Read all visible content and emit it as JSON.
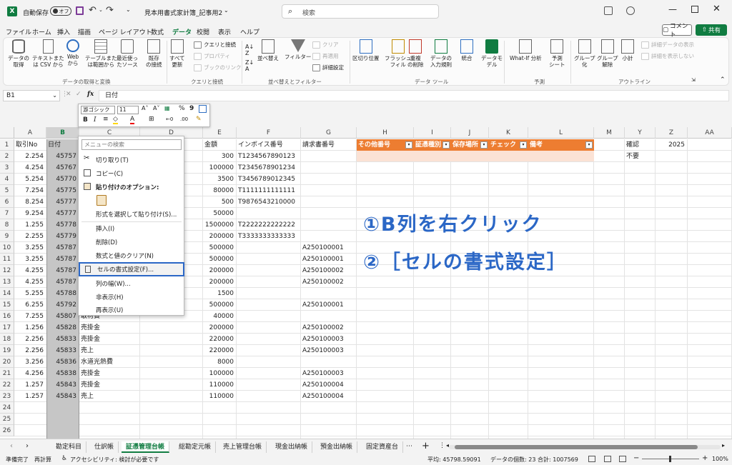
{
  "titlebar": {
    "autosave_label": "自動保存",
    "autosave_state": "オフ",
    "filename": "見本用書式家計簿_記事用2",
    "search_placeholder": "検索"
  },
  "menutabs": [
    "ファイル",
    "ホーム",
    "挿入",
    "描画",
    "ページ レイアウト",
    "数式",
    "データ",
    "校閲",
    "表示",
    "ヘルプ"
  ],
  "comment_btn": "コメント",
  "share_btn": "共有",
  "ribbon": {
    "get": {
      "b1": "データの\n取得",
      "b2": "テキストまた\nは CSV から",
      "b3": "Web\nから",
      "b4": "テーブルまた\nは範囲から",
      "b5": "最近使っ\nたソース",
      "b6": "既存\nの接続",
      "group": "データの取得と変換"
    },
    "query": {
      "b1": "すべて\n更新",
      "s1": "クエリと接続",
      "s2": "プロパティ",
      "s3": "ブックのリンク",
      "group": "クエリと接続"
    },
    "sort": {
      "b1": "並べ替え",
      "b2": "フィルター",
      "s1": "クリア",
      "s2": "再適用",
      "s3": "詳細設定",
      "group": "並べ替えとフィルター"
    },
    "tools": {
      "b1": "区切り位置",
      "b2": "フラッシュ\nフィル",
      "b3": "重複\nの削除",
      "b4": "データの\n入力規則",
      "b5": "統合",
      "b6": "データモ\nデル",
      "group": "データ ツール"
    },
    "forecast": {
      "b1": "What-If 分析",
      "b2": "予測\nシート",
      "group": "予測"
    },
    "outline": {
      "b1": "グループ\n化",
      "b2": "グループ\n解除",
      "b3": "小計",
      "s1": "詳細データの表示",
      "s2": "詳細を表示しない",
      "group": "アウトライン"
    }
  },
  "formula": {
    "namebox": "B1",
    "fx": "fx",
    "content": "日付"
  },
  "minitoolbar": {
    "font": "游ゴシック",
    "size": "11",
    "bold": "B",
    "italic": "I",
    "pct": "%",
    "comma": "9"
  },
  "columns": [
    "A",
    "B",
    "C",
    "D",
    "E",
    "F",
    "G",
    "H",
    "I",
    "J",
    "K",
    "L",
    "M",
    "Y",
    "Z",
    "AA"
  ],
  "rows": [
    "1",
    "2",
    "3",
    "4",
    "5",
    "6",
    "7",
    "8",
    "9",
    "10",
    "11",
    "12",
    "13",
    "14",
    "15",
    "16",
    "17",
    "18",
    "19",
    "20",
    "21",
    "22",
    "23",
    "24",
    "25",
    "26"
  ],
  "headers": {
    "a": "取引No",
    "b": "日付",
    "e": "金額",
    "f": "インボイス番号",
    "g": "請求書番号",
    "h": "その他番号",
    "i": "証憑種別",
    "j": "保存場所",
    "k": "チェック",
    "l": "備考",
    "y": "確認",
    "z": "2025",
    "y2": "不要"
  },
  "data": {
    "a": [
      "2.254",
      "4.254",
      "5.254",
      "7.254",
      "8.254",
      "9.254",
      "1.255",
      "2.255",
      "3.255",
      "3.255",
      "4.255",
      "4.255",
      "5.255",
      "6.255",
      "7.255",
      "1.256",
      "2.256",
      "2.256",
      "3.256",
      "4.256",
      "1.257",
      "1.257"
    ],
    "b": [
      "45757",
      "45767",
      "45770",
      "45775",
      "45777",
      "45777",
      "45778",
      "45779",
      "45787",
      "45787",
      "45787",
      "45787",
      "45788",
      "45792",
      "45807",
      "45828",
      "45833",
      "45833",
      "45836",
      "45838",
      "45843",
      "45843"
    ],
    "c": [
      "",
      "",
      "",
      "",
      "",
      "",
      "",
      "",
      "",
      "",
      "",
      "",
      "",
      "",
      "取材費",
      "売掛金",
      "売掛金",
      "売上",
      "水道光熱費",
      "売掛金",
      "売掛金",
      "売上"
    ],
    "e": [
      "300",
      "100000",
      "3500",
      "80000",
      "500",
      "50000",
      "1500000",
      "200000",
      "500000",
      "500000",
      "200000",
      "200000",
      "1500",
      "500000",
      "40000",
      "200000",
      "220000",
      "220000",
      "8000",
      "100000",
      "110000",
      "110000"
    ],
    "f": [
      "T1234567890123",
      "T2345678901234",
      "T3456789012345",
      "T1111111111111",
      "T9876543210000",
      "",
      "T2222222222222",
      "T3333333333333",
      "",
      "",
      "",
      "",
      "",
      "",
      "",
      "",
      "",
      "",
      "",
      "",
      "",
      ""
    ],
    "g": [
      "",
      "",
      "",
      "",
      "",
      "",
      "",
      "",
      "A250100001",
      "A250100001",
      "A250100002",
      "A250100002",
      "",
      "A250100001",
      "",
      "A250100002",
      "A250100003",
      "A250100003",
      "",
      "A250100003",
      "A250100004",
      "A250100004"
    ]
  },
  "contextmenu": {
    "search": "メニューの検索",
    "cut": "切り取り(T)",
    "copy": "コピー(C)",
    "paste_options": "貼り付けのオプション:",
    "paste_special": "形式を選択して貼り付け(S)...",
    "insert": "挿入(I)",
    "delete": "削除(D)",
    "clear": "数式と値のクリア(N)",
    "format_cells": "セルの書式設定(F)...",
    "col_width": "列の幅(W)...",
    "hide": "非表示(H)",
    "unhide": "再表示(U)"
  },
  "annotation": {
    "line1": "①B列を右クリック",
    "line2": "②［セルの書式設定］"
  },
  "sheets": [
    "勘定科目",
    "仕訳帳",
    "証憑管理台帳",
    "総勘定元帳",
    "売上管理台帳",
    "現金出納帳",
    "預金出納帳",
    "固定資産台"
  ],
  "status": {
    "ready": "準備完了",
    "calc": "再計算",
    "access": "アクセシビリティ: 検討が必要です",
    "avg": "平均: 45798.59091",
    "count": "データの個数: 23",
    "sum": "合計: 1007569",
    "zoom": "100%"
  },
  "colors": {
    "accent": "#107c41",
    "orange": "#ed7d31",
    "annot": "#2b67c6",
    "selcol": "#c6c6c6"
  }
}
